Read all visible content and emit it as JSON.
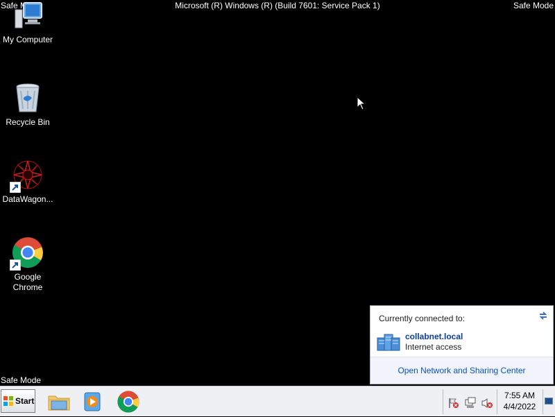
{
  "overlay": {
    "safe_mode": "Safe Mode",
    "title": "Microsoft (R) Windows (R) (Build 7601: Service Pack 1)"
  },
  "desktop_icons": [
    {
      "label": "My Computer",
      "icon": "computer-icon"
    },
    {
      "label": "Recycle Bin",
      "icon": "recycle-bin-icon"
    },
    {
      "label": "DataWagon...",
      "icon": "datawagon-icon"
    },
    {
      "label": "Google Chrome",
      "icon": "chrome-icon"
    }
  ],
  "network_flyout": {
    "header": "Currently connected to:",
    "network_name": "collabnet.local",
    "network_status": "Internet access",
    "footer_link": "Open Network and Sharing Center"
  },
  "taskbar": {
    "start_label": "Start",
    "pinned": [
      {
        "name": "Windows Explorer",
        "icon": "folder-icon"
      },
      {
        "name": "Windows Media Player",
        "icon": "media-player-icon"
      },
      {
        "name": "Google Chrome",
        "icon": "chrome-icon"
      }
    ],
    "clock": {
      "time": "7:55 AM",
      "date": "4/4/2022"
    }
  },
  "colors": {
    "desktop_bg": "#000000",
    "link": "#0b4ebd",
    "network_name": "#0a3f9e"
  }
}
